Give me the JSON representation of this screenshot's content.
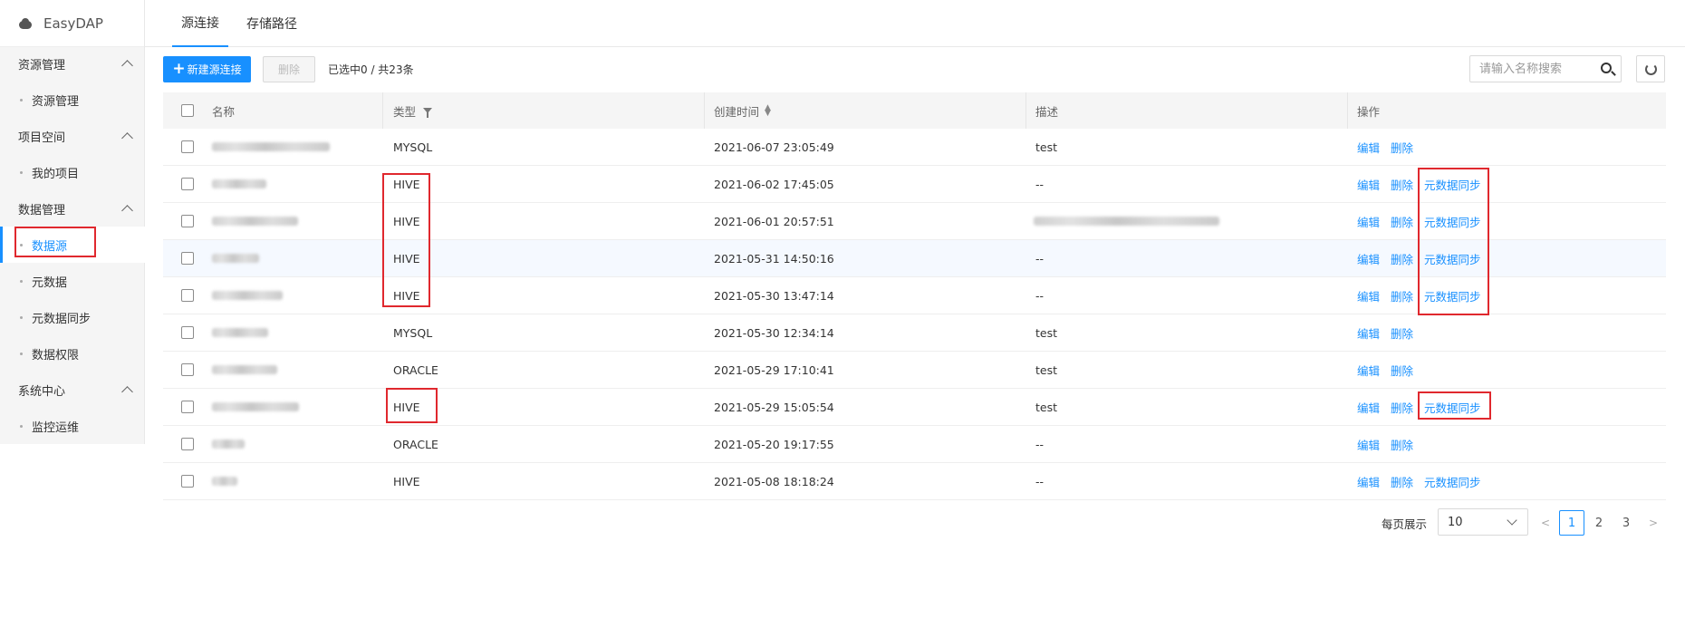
{
  "app": {
    "brand": "EasyDAP"
  },
  "sidebar": {
    "groups": [
      {
        "label": "资源管理",
        "items": [
          "资源管理"
        ]
      },
      {
        "label": "项目空间",
        "items": [
          "我的项目"
        ]
      },
      {
        "label": "数据管理",
        "items": [
          "数据源",
          "元数据",
          "元数据同步",
          "数据权限"
        ]
      },
      {
        "label": "系统中心",
        "items": [
          "监控运维"
        ]
      }
    ],
    "active_item": "数据源"
  },
  "tabs": [
    "源连接",
    "存储路径"
  ],
  "active_tab": "源连接",
  "toolbar": {
    "new_label": "新建源连接",
    "delete_label": "删除",
    "selection_info": "已选中0 / 共23条",
    "search_placeholder": "请输入名称搜索"
  },
  "table": {
    "headers": {
      "name": "名称",
      "type": "类型",
      "created": "创建时间",
      "desc": "描述",
      "ops": "操作"
    },
    "ops_labels": {
      "edit": "编辑",
      "delete": "删除",
      "sync": "元数据同步"
    },
    "rows": [
      {
        "type": "MYSQL",
        "created": "2021-06-07 23:05:49",
        "desc": "test",
        "sync": false
      },
      {
        "type": "HIVE",
        "created": "2021-06-02 17:45:05",
        "desc": "--",
        "sync": true
      },
      {
        "type": "HIVE",
        "created": "2021-06-01 20:57:51",
        "desc": "",
        "sync": true
      },
      {
        "type": "HIVE",
        "created": "2021-05-31 14:50:16",
        "desc": "--",
        "sync": true
      },
      {
        "type": "HIVE",
        "created": "2021-05-30 13:47:14",
        "desc": "--",
        "sync": true
      },
      {
        "type": "MYSQL",
        "created": "2021-05-30 12:34:14",
        "desc": "test",
        "sync": false
      },
      {
        "type": "ORACLE",
        "created": "2021-05-29 17:10:41",
        "desc": "test",
        "sync": false
      },
      {
        "type": "HIVE",
        "created": "2021-05-29 15:05:54",
        "desc": "test",
        "sync": true
      },
      {
        "type": "ORACLE",
        "created": "2021-05-20 19:17:55",
        "desc": "--",
        "sync": false
      },
      {
        "type": "HIVE",
        "created": "2021-05-08 18:18:24",
        "desc": "--",
        "sync": true
      }
    ]
  },
  "pagination": {
    "page_size_label": "每页展示",
    "page_size": "10",
    "pages": [
      "1",
      "2",
      "3"
    ],
    "current": "1",
    "prev": "<",
    "next": ">"
  }
}
